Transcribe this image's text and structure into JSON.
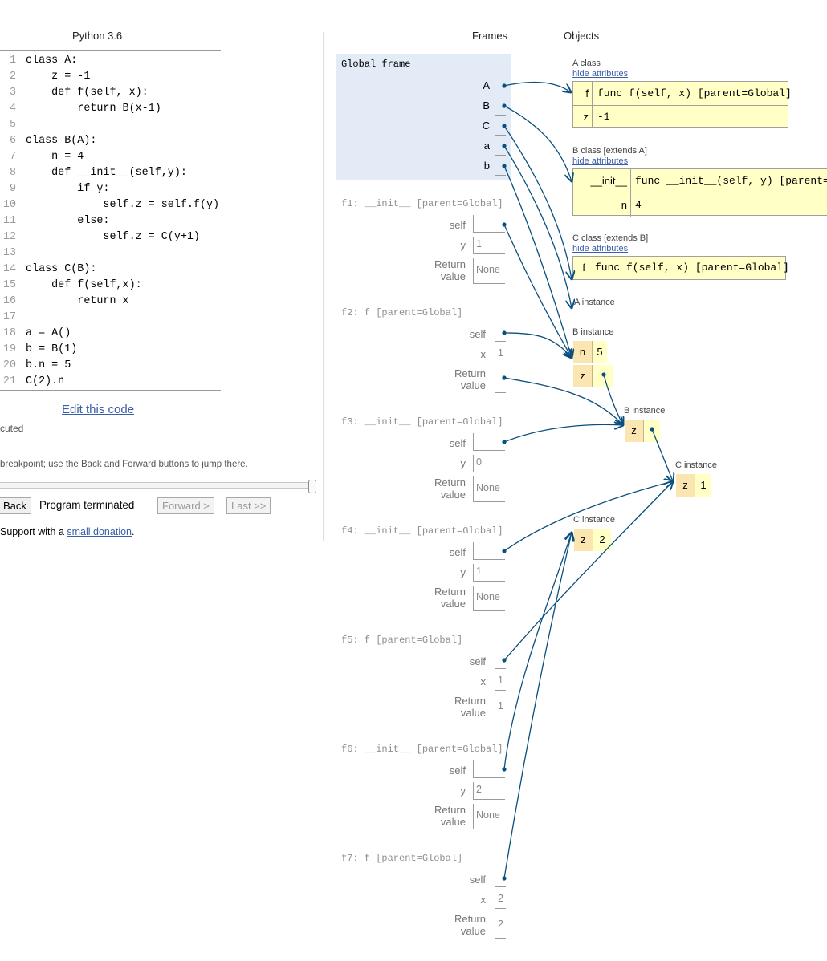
{
  "code_panel": {
    "language": "Python 3.6",
    "lines": [
      {
        "n": "1",
        "text": "class A:"
      },
      {
        "n": "2",
        "text": "    z = -1"
      },
      {
        "n": "3",
        "text": "    def f(self, x):"
      },
      {
        "n": "4",
        "text": "        return B(x-1)"
      },
      {
        "n": "5",
        "text": ""
      },
      {
        "n": "6",
        "text": "class B(A):"
      },
      {
        "n": "7",
        "text": "    n = 4"
      },
      {
        "n": "8",
        "text": "    def __init__(self,y):"
      },
      {
        "n": "9",
        "text": "        if y:"
      },
      {
        "n": "10",
        "text": "            self.z = self.f(y)"
      },
      {
        "n": "11",
        "text": "        else:"
      },
      {
        "n": "12",
        "text": "            self.z = C(y+1)"
      },
      {
        "n": "13",
        "text": ""
      },
      {
        "n": "14",
        "text": "class C(B):"
      },
      {
        "n": "15",
        "text": "    def f(self,x):"
      },
      {
        "n": "16",
        "text": "        return x"
      },
      {
        "n": "17",
        "text": ""
      },
      {
        "n": "18",
        "text": "a = A()"
      },
      {
        "n": "19",
        "text": "b = B(1)"
      },
      {
        "n": "20",
        "text": "b.n = 5"
      },
      {
        "n": "21",
        "text": "C(2).n"
      }
    ],
    "edit_link": "Edit this code",
    "exec_status": "cuted",
    "breakpoint_hint": "breakpoint; use the Back and Forward buttons to jump there.",
    "back_button": "Back",
    "program_status": "Program terminated",
    "forward_button": "Forward >",
    "last_button": "Last >>",
    "support_prefix": "Support with a ",
    "support_link": "small donation",
    "support_suffix": "."
  },
  "visualizer": {
    "frames_header": "Frames",
    "objects_header": "Objects",
    "global_frame": {
      "title": "Global frame",
      "vars": [
        "A",
        "B",
        "C",
        "a",
        "b"
      ]
    },
    "frames": [
      {
        "title": "f1: __init__ [parent=Global]",
        "param_name": "y",
        "param_value": "1",
        "return_label": "Return value",
        "return_value": "None",
        "return_pointer": false
      },
      {
        "title": "f2: f [parent=Global]",
        "param_name": "x",
        "param_value": "1",
        "return_label": "Return value",
        "return_value": "",
        "return_pointer": true
      },
      {
        "title": "f3: __init__ [parent=Global]",
        "param_name": "y",
        "param_value": "0",
        "return_label": "Return value",
        "return_value": "None",
        "return_pointer": false
      },
      {
        "title": "f4: __init__ [parent=Global]",
        "param_name": "y",
        "param_value": "1",
        "return_label": "Return value",
        "return_value": "None",
        "return_pointer": false
      },
      {
        "title": "f5: f [parent=Global]",
        "param_name": "x",
        "param_value": "1",
        "return_label": "Return value",
        "return_value": "1",
        "return_pointer": false
      },
      {
        "title": "f6: __init__ [parent=Global]",
        "param_name": "y",
        "param_value": "2",
        "return_label": "Return value",
        "return_value": "None",
        "return_pointer": false
      },
      {
        "title": "f7: f [parent=Global]",
        "param_name": "x",
        "param_value": "2",
        "return_label": "Return value",
        "return_value": "2",
        "return_pointer": false
      }
    ],
    "self_label": "self",
    "hide_attributes": "hide attributes",
    "objects": {
      "class_a": {
        "label": "A class",
        "attrs": [
          {
            "key": "f",
            "value": "func f(self, x) [parent=Global]"
          },
          {
            "key": "z",
            "value": "-1"
          }
        ]
      },
      "class_b": {
        "label": "B class [extends A]",
        "attrs": [
          {
            "key": "__init__",
            "value": "func __init__(self, y) [parent=Gl"
          },
          {
            "key": "n",
            "value": "4"
          }
        ]
      },
      "class_c": {
        "label": "C class [extends B]",
        "attrs": [
          {
            "key": "f",
            "value": "func f(self, x) [parent=Global]"
          }
        ]
      },
      "a_instance": {
        "label": "A instance"
      },
      "b_instance_1": {
        "label": "B instance",
        "attrs": [
          {
            "key": "n",
            "value": "5"
          },
          {
            "key": "z",
            "value": ""
          }
        ]
      },
      "b_instance_2": {
        "label": "B instance",
        "attrs": [
          {
            "key": "z",
            "value": ""
          }
        ]
      },
      "c_instance_1": {
        "label": "C instance",
        "attrs": [
          {
            "key": "z",
            "value": "1"
          }
        ]
      },
      "c_instance_2": {
        "label": "C instance",
        "attrs": [
          {
            "key": "z",
            "value": "2"
          }
        ]
      }
    },
    "colors": {
      "pointer": "#0a4f7d",
      "global_frame_bg": "#e2ebf6",
      "attr_bg": "#ffffc6",
      "key_bg": "#fbe6b2",
      "link": "#3a5ea8"
    }
  }
}
